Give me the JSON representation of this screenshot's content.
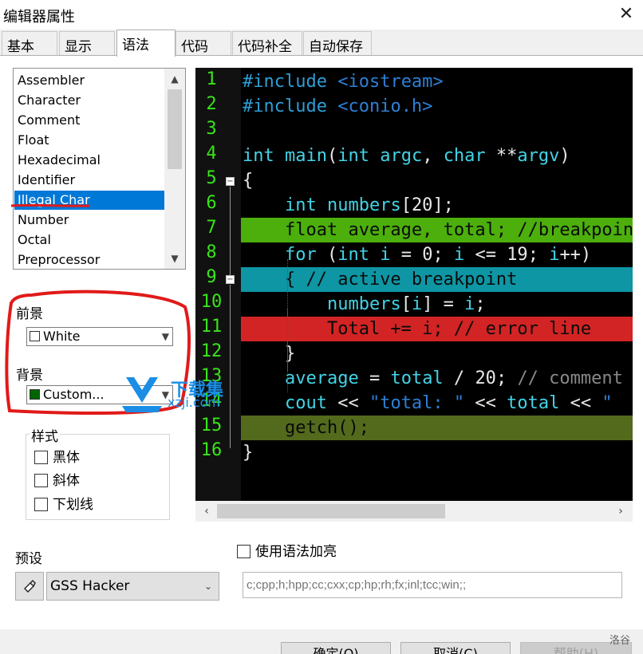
{
  "window": {
    "title": "编辑器属性",
    "close_glyph": "✕"
  },
  "tabs": [
    {
      "label": "基本",
      "active": false
    },
    {
      "label": "显示",
      "active": false
    },
    {
      "label": "语法",
      "active": true
    },
    {
      "label": "代码",
      "active": false
    },
    {
      "label": "代码补全",
      "active": false
    },
    {
      "label": "自动保存",
      "active": false
    }
  ],
  "element_list": {
    "items": [
      "Assembler",
      "Character",
      "Comment",
      "Float",
      "Hexadecimal",
      "Identifier",
      "Illegal Char",
      "Number",
      "Octal",
      "Preprocessor"
    ],
    "selected": "Illegal Char"
  },
  "foreground": {
    "label": "前景",
    "value": "White",
    "swatch_color": "#ffffff"
  },
  "background": {
    "label": "背景",
    "value": "Custom...",
    "swatch_color": "#006400"
  },
  "style_group": {
    "legend": "样式",
    "options": [
      {
        "label": "黑体",
        "checked": false
      },
      {
        "label": "斜体",
        "checked": false
      },
      {
        "label": "下划线",
        "checked": false
      }
    ]
  },
  "editor": {
    "line_numbers": [
      "1",
      "2",
      "3",
      "4",
      "5",
      "6",
      "7",
      "8",
      "9",
      "10",
      "11",
      "12",
      "13",
      "14",
      "15",
      "16"
    ],
    "line_backgrounds": {
      "7": "#4caf0c",
      "9": "#0e96a4",
      "11": "#d22424",
      "15": "#536a1c"
    },
    "lines": [
      [
        [
          "pre",
          "#include "
        ],
        [
          "str",
          "<iostream>"
        ]
      ],
      [
        [
          "pre",
          "#include "
        ],
        [
          "str",
          "<conio.h>"
        ]
      ],
      [],
      [
        [
          "type",
          "int "
        ],
        [
          "id",
          "main"
        ],
        [
          "op",
          "("
        ],
        [
          "type",
          "int "
        ],
        [
          "id",
          "argc"
        ],
        [
          "op",
          ", "
        ],
        [
          "type",
          "char "
        ],
        [
          "op",
          "**"
        ],
        [
          "id",
          "argv"
        ],
        [
          "op",
          ")"
        ]
      ],
      [
        [
          "op",
          "{"
        ]
      ],
      [
        [
          "plain",
          "    "
        ],
        [
          "type",
          "int "
        ],
        [
          "id",
          "numbers"
        ],
        [
          "op",
          "["
        ],
        [
          "num",
          "20"
        ],
        [
          "op",
          "];"
        ]
      ],
      [
        [
          "plain",
          "    float average, total; //breakpoint"
        ]
      ],
      [
        [
          "plain",
          "    "
        ],
        [
          "kw",
          "for "
        ],
        [
          "op",
          "("
        ],
        [
          "type",
          "int "
        ],
        [
          "id",
          "i"
        ],
        [
          "op",
          " = "
        ],
        [
          "num",
          "0"
        ],
        [
          "op",
          "; "
        ],
        [
          "id",
          "i"
        ],
        [
          "op",
          " <= "
        ],
        [
          "num",
          "19"
        ],
        [
          "op",
          "; "
        ],
        [
          "id",
          "i"
        ],
        [
          "op",
          "++)"
        ]
      ],
      [
        [
          "plain",
          "    { // active breakpoint"
        ]
      ],
      [
        [
          "plain",
          "        "
        ],
        [
          "id",
          "numbers"
        ],
        [
          "op",
          "["
        ],
        [
          "id",
          "i"
        ],
        [
          "op",
          "] = "
        ],
        [
          "id",
          "i"
        ],
        [
          "op",
          ";"
        ]
      ],
      [
        [
          "plain",
          "        Total += i; // error line"
        ]
      ],
      [
        [
          "plain",
          "    "
        ],
        [
          "op",
          "}"
        ]
      ],
      [
        [
          "plain",
          "    "
        ],
        [
          "id",
          "average"
        ],
        [
          "op",
          " = "
        ],
        [
          "id",
          "total"
        ],
        [
          "op",
          " / "
        ],
        [
          "num",
          "20"
        ],
        [
          "op",
          "; "
        ],
        [
          "cm",
          "// comment"
        ]
      ],
      [
        [
          "plain",
          "    "
        ],
        [
          "id",
          "cout"
        ],
        [
          "op",
          " << "
        ],
        [
          "str",
          "\"total: \""
        ],
        [
          "op",
          " << "
        ],
        [
          "id",
          "total"
        ],
        [
          "op",
          " << "
        ],
        [
          "str",
          "\""
        ]
      ],
      [
        [
          "plain",
          "    getch();"
        ]
      ],
      [
        [
          "op",
          "}"
        ]
      ]
    ]
  },
  "presets": {
    "label": "预设",
    "icon": "brush-icon",
    "value": "GSS Hacker"
  },
  "syntax_highlight": {
    "label": "使用语法加亮",
    "checked": false
  },
  "extensions": {
    "placeholder": "c;cpp;h;hpp;cc;cxx;cp;hp;rh;fx;inl;tcc;win;;"
  },
  "buttons": {
    "ok": "确定(O)",
    "cancel": "取消(C)",
    "help": "帮助(H)"
  },
  "watermark": {
    "text": "下载集",
    "sub": "xzji.com"
  },
  "corner_mark": "洛谷"
}
